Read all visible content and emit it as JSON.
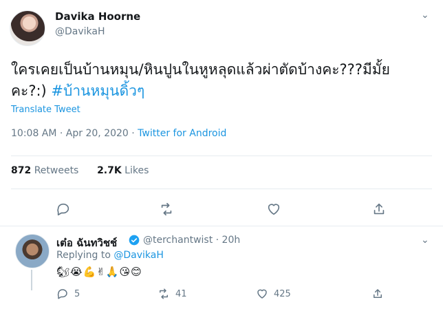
{
  "tweet": {
    "display_name": "Davika Hoorne",
    "handle": "@DavikaH",
    "text_line1": "ใครเคยเป็นบ้านหมุน/หินปูนในหูหลุดแล้วผ่าตัดบ้างคะ???มีมั้ย",
    "text_line2_prefix": "คะ?:) ",
    "hashtag": "#บ้านหมุนดิ้วๆ",
    "translate_label": "Translate Tweet",
    "time": "10:08 AM · Apr 20, 2020 · ",
    "source": "Twitter for Android",
    "retweets_count": "872",
    "retweets_label": "Retweets",
    "likes_count": "2.7K",
    "likes_label": "Likes",
    "chevron": "⌄"
  },
  "reply": {
    "display_name": "เต๋อ ฉันทวิชช์",
    "handle_time": "@terchantwist · 20h",
    "replying_prefix": "Replying to ",
    "replying_handle": "@DavikaH",
    "emojis": "🐿😭💪✌🙏😘😊",
    "reply_count": "5",
    "retweet_count": "41",
    "like_count": "425",
    "chevron": "⌄"
  },
  "colors": {
    "accent": "#1b95e0",
    "muted": "#657786",
    "verified": "#1da1f2"
  },
  "icons": [
    "reply-icon",
    "retweet-icon",
    "like-icon",
    "share-icon",
    "verified-icon",
    "chevron-down-icon"
  ]
}
